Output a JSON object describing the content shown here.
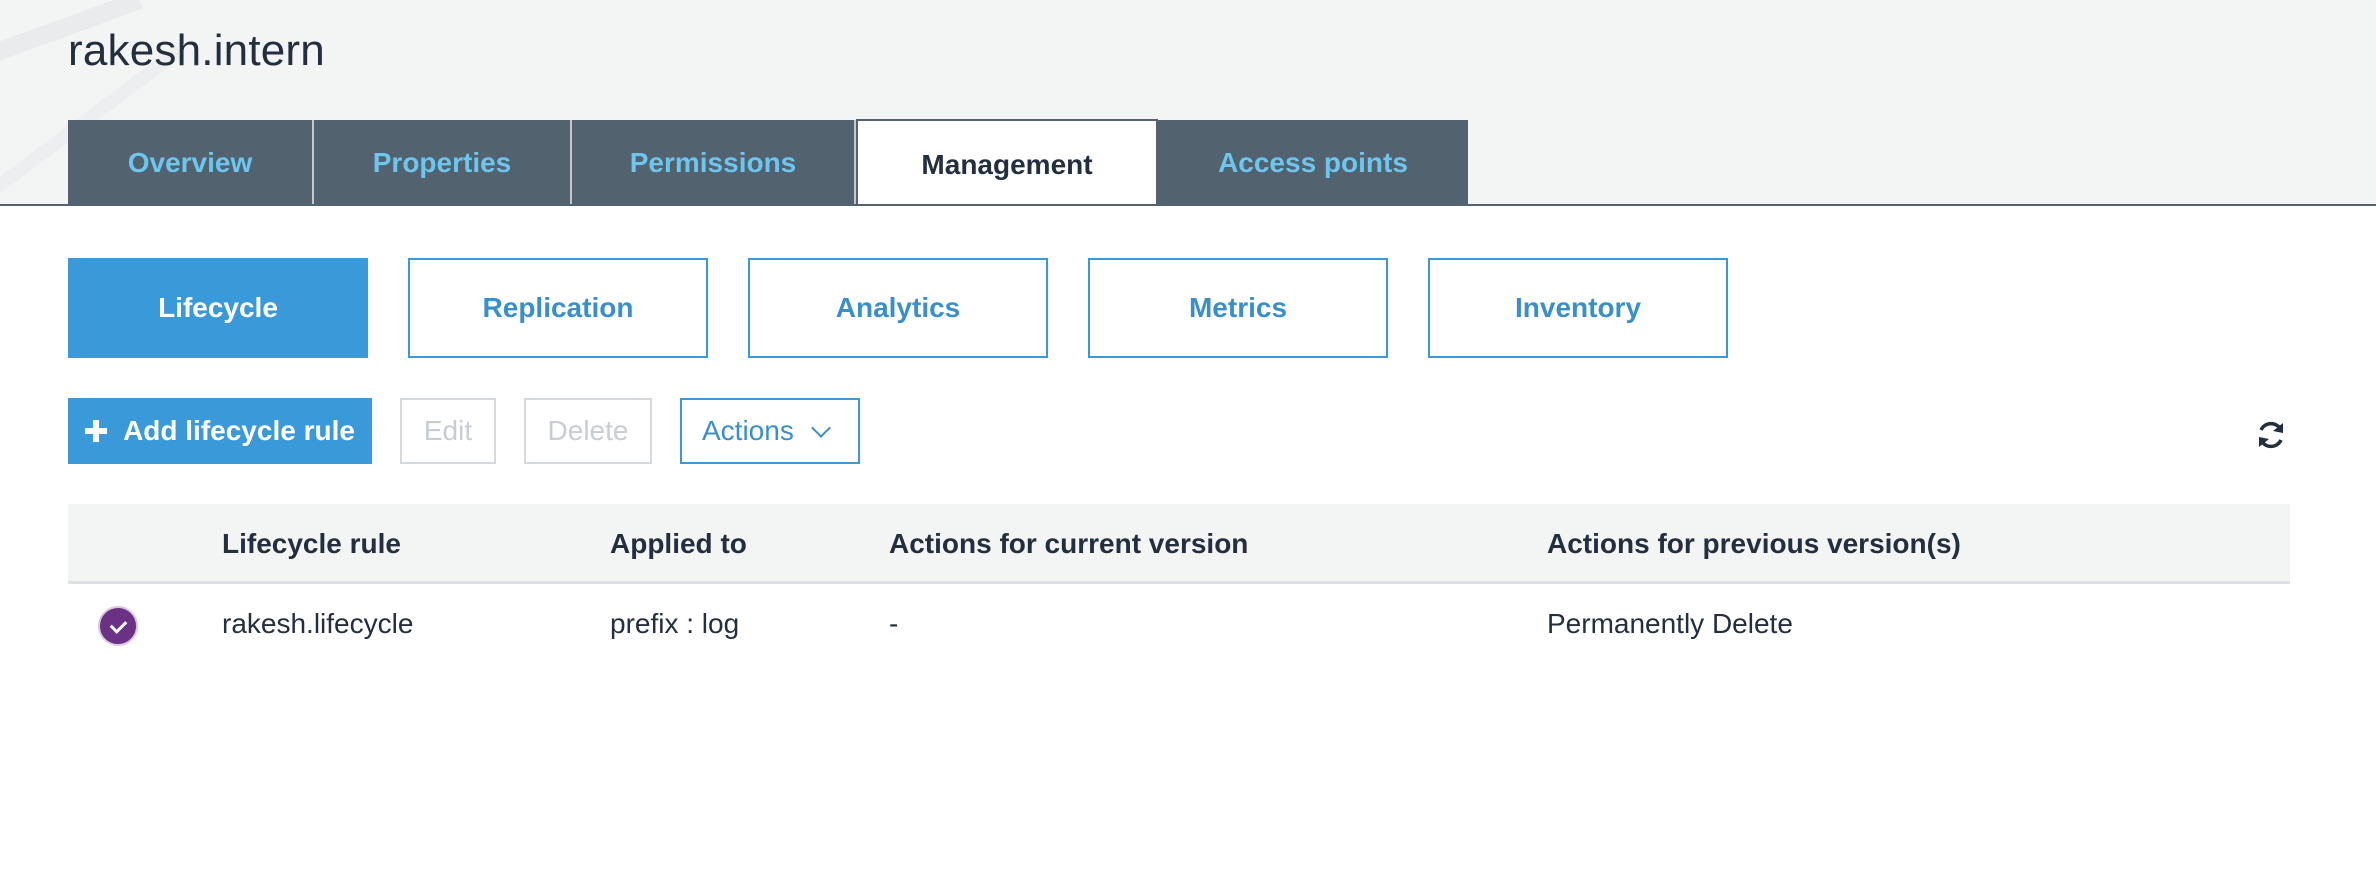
{
  "header": {
    "bucket_name": "rakesh.intern",
    "tabs": [
      {
        "label": "Overview",
        "active": false
      },
      {
        "label": "Properties",
        "active": false
      },
      {
        "label": "Permissions",
        "active": false
      },
      {
        "label": "Management",
        "active": true
      },
      {
        "label": "Access points",
        "active": false
      }
    ]
  },
  "subtabs": [
    {
      "label": "Lifecycle",
      "active": true
    },
    {
      "label": "Replication",
      "active": false
    },
    {
      "label": "Analytics",
      "active": false
    },
    {
      "label": "Metrics",
      "active": false
    },
    {
      "label": "Inventory",
      "active": false
    }
  ],
  "toolbar": {
    "add_label": "Add lifecycle rule",
    "edit_label": "Edit",
    "delete_label": "Delete",
    "actions_label": "Actions",
    "refresh_icon": "refresh-icon"
  },
  "table": {
    "columns": [
      "Lifecycle rule",
      "Applied to",
      "Actions for current version",
      "Actions for previous version(s)"
    ],
    "rows": [
      {
        "selected": true,
        "rule": "rakesh.lifecycle",
        "applied_to": "prefix : log",
        "current_version": "-",
        "previous_versions": "Permanently Delete"
      }
    ]
  },
  "colors": {
    "accent": "#3a9ad9",
    "tab_bar": "#52626f",
    "tab_text": "#6cc6ee",
    "selected_check": "#6a3184"
  }
}
